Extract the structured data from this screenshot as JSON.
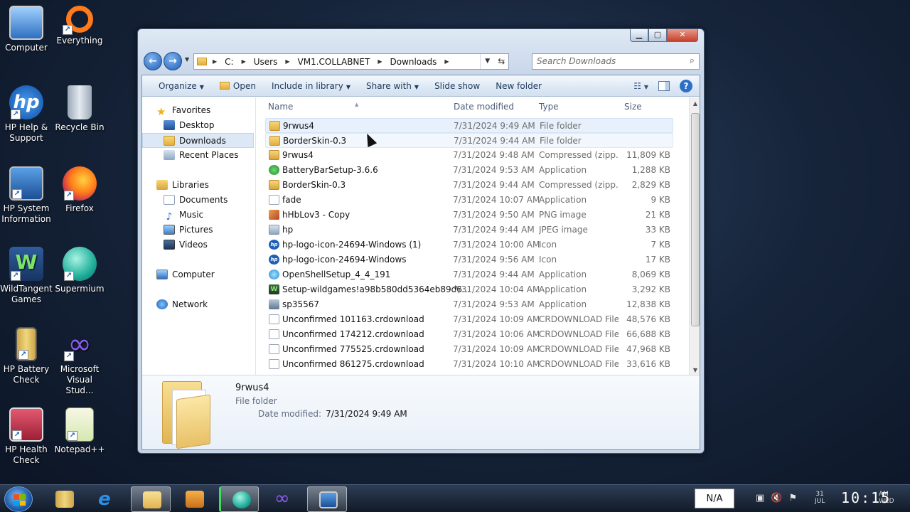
{
  "desktop": {
    "icons": [
      {
        "label": "Computer",
        "icon": "computer-icon"
      },
      {
        "label": "Everything",
        "icon": "everything-icon"
      },
      {
        "label": "HP Help & Support",
        "icon": "hp-icon"
      },
      {
        "label": "Recycle Bin",
        "icon": "recycle-bin-icon"
      },
      {
        "label": "HP System Information",
        "icon": "hp-system-info-icon"
      },
      {
        "label": "Firefox",
        "icon": "firefox-icon"
      },
      {
        "label": "WildTangent Games",
        "icon": "wildtangent-icon"
      },
      {
        "label": "Supermium",
        "icon": "supermium-icon"
      },
      {
        "label": "HP Battery Check",
        "icon": "battery-check-icon"
      },
      {
        "label": "Microsoft Visual Stud...",
        "icon": "visual-studio-icon"
      },
      {
        "label": "HP Health Check",
        "icon": "health-check-icon"
      },
      {
        "label": "Notepad++",
        "icon": "notepad-plus-plus-icon"
      }
    ]
  },
  "window": {
    "address": {
      "segments": [
        "C:",
        "Users",
        "VM1.COLLABNET",
        "Downloads"
      ]
    },
    "search": {
      "placeholder": "Search Downloads"
    },
    "toolbar": {
      "organize": "Organize",
      "open": "Open",
      "include_in_library": "Include in library",
      "share_with": "Share with",
      "slide_show": "Slide show",
      "new_folder": "New folder"
    },
    "nav": {
      "favorites": "Favorites",
      "desktop": "Desktop",
      "downloads": "Downloads",
      "recent_places": "Recent Places",
      "libraries": "Libraries",
      "documents": "Documents",
      "music": "Music",
      "pictures": "Pictures",
      "videos": "Videos",
      "computer": "Computer",
      "network": "Network"
    },
    "columns": {
      "name": "Name",
      "date": "Date modified",
      "type": "Type",
      "size": "Size"
    },
    "files": [
      {
        "name": "9rwus4",
        "date": "7/31/2024 9:49 AM",
        "type": "File folder",
        "size": "",
        "icon": "folder"
      },
      {
        "name": "BorderSkin-0.3",
        "date": "7/31/2024 9:44 AM",
        "type": "File folder",
        "size": "",
        "icon": "folder"
      },
      {
        "name": "9rwus4",
        "date": "7/31/2024 9:48 AM",
        "type": "Compressed (zipp...",
        "size": "11,809 KB",
        "icon": "zip"
      },
      {
        "name": "BatteryBarSetup-3.6.6",
        "date": "7/31/2024 9:53 AM",
        "type": "Application",
        "size": "1,288 KB",
        "icon": "app-green"
      },
      {
        "name": "BorderSkin-0.3",
        "date": "7/31/2024 9:44 AM",
        "type": "Compressed (zipp...",
        "size": "2,829 KB",
        "icon": "zip"
      },
      {
        "name": "fade",
        "date": "7/31/2024 10:07 AM",
        "type": "Application",
        "size": "9 KB",
        "icon": "file"
      },
      {
        "name": "hHbLov3 - Copy",
        "date": "7/31/2024 9:50 AM",
        "type": "PNG image",
        "size": "21 KB",
        "icon": "png"
      },
      {
        "name": "hp",
        "date": "7/31/2024 9:44 AM",
        "type": "JPEG image",
        "size": "33 KB",
        "icon": "jpg"
      },
      {
        "name": "hp-logo-icon-24694-Windows (1)",
        "date": "7/31/2024 10:00 AM",
        "type": "Icon",
        "size": "7 KB",
        "icon": "hpi"
      },
      {
        "name": "hp-logo-icon-24694-Windows",
        "date": "7/31/2024 9:56 AM",
        "type": "Icon",
        "size": "17 KB",
        "icon": "hpi"
      },
      {
        "name": "OpenShellSetup_4_4_191",
        "date": "7/31/2024 9:44 AM",
        "type": "Application",
        "size": "8,069 KB",
        "icon": "shell"
      },
      {
        "name": "Setup-wildgames!a98b580dd5364eb89d6...",
        "date": "7/31/2024 10:04 AM",
        "type": "Application",
        "size": "3,292 KB",
        "icon": "wild"
      },
      {
        "name": "sp35567",
        "date": "7/31/2024 9:53 AM",
        "type": "Application",
        "size": "12,838 KB",
        "icon": "sp"
      },
      {
        "name": "Unconfirmed 101163.crdownload",
        "date": "7/31/2024 10:09 AM",
        "type": "CRDOWNLOAD File",
        "size": "48,576 KB",
        "icon": "file"
      },
      {
        "name": "Unconfirmed 174212.crdownload",
        "date": "7/31/2024 10:06 AM",
        "type": "CRDOWNLOAD File",
        "size": "66,688 KB",
        "icon": "file"
      },
      {
        "name": "Unconfirmed 775525.crdownload",
        "date": "7/31/2024 10:09 AM",
        "type": "CRDOWNLOAD File",
        "size": "47,968 KB",
        "icon": "file"
      },
      {
        "name": "Unconfirmed 861275.crdownload",
        "date": "7/31/2024 10:10 AM",
        "type": "CRDOWNLOAD File",
        "size": "33,616 KB",
        "icon": "file"
      }
    ],
    "details": {
      "name": "9rwus4",
      "type": "File folder",
      "modified_label": "Date modified:",
      "modified_value": "7/31/2024 9:49 AM"
    }
  },
  "taskbar": {
    "language": "N/A",
    "clock": "10:15",
    "ampm": "AM",
    "weekday": "WED",
    "day": "31",
    "month": "JUL"
  }
}
